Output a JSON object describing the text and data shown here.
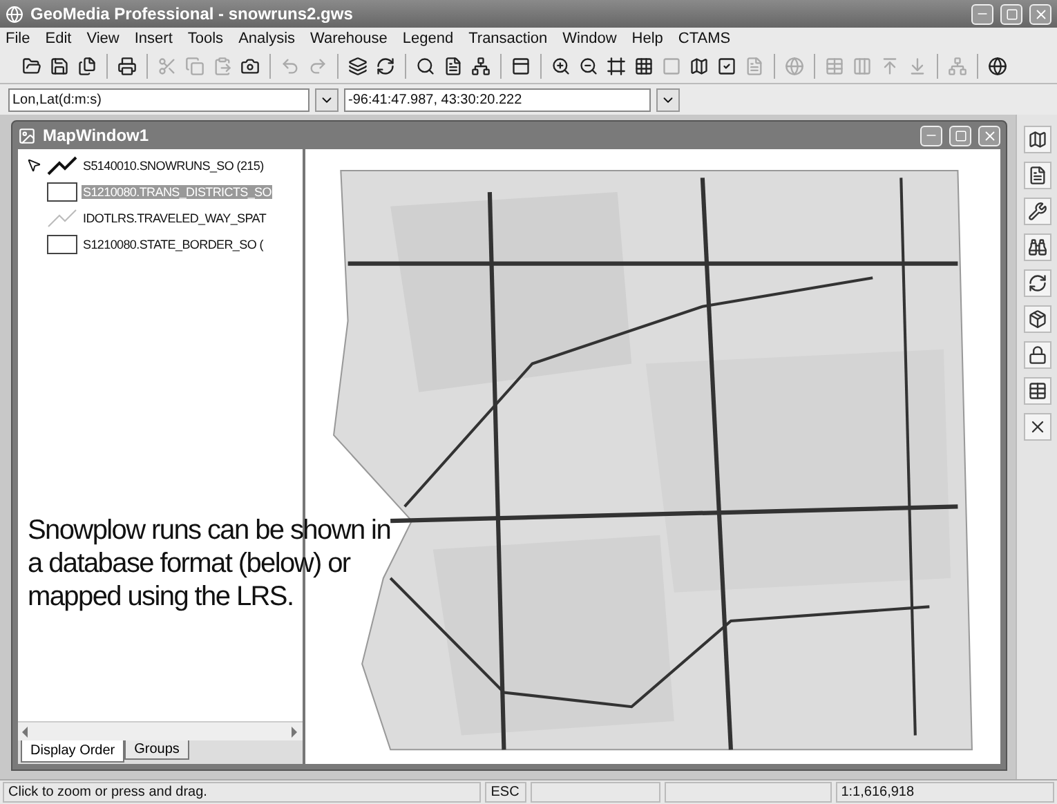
{
  "window": {
    "title": "GeoMedia Professional - snowruns2.gws"
  },
  "menu": [
    "File",
    "Edit",
    "View",
    "Insert",
    "Tools",
    "Analysis",
    "Warehouse",
    "Legend",
    "Transaction",
    "Window",
    "Help",
    "CTAMS"
  ],
  "toolbar_groups": [
    [
      {
        "disabled": false
      },
      {
        "disabled": false
      },
      {
        "disabled": false
      }
    ],
    [
      {
        "disabled": false
      }
    ],
    [
      {
        "disabled": true
      },
      {
        "disabled": true
      },
      {
        "disabled": true
      },
      {
        "disabled": false
      }
    ],
    [
      {
        "disabled": true
      },
      {
        "disabled": true
      }
    ],
    [
      {
        "disabled": false
      },
      {
        "disabled": false
      }
    ],
    [
      {
        "disabled": false
      },
      {
        "disabled": false
      },
      {
        "disabled": false
      }
    ],
    [
      {
        "disabled": false
      }
    ],
    [
      {
        "disabled": false
      },
      {
        "disabled": false
      },
      {
        "disabled": false
      },
      {
        "disabled": false
      },
      {
        "disabled": true
      },
      {
        "disabled": false
      },
      {
        "disabled": false
      },
      {
        "disabled": true
      }
    ],
    [
      {
        "disabled": true
      }
    ],
    [
      {
        "disabled": true
      },
      {
        "disabled": true
      },
      {
        "disabled": true
      },
      {
        "disabled": true
      }
    ],
    [
      {
        "disabled": true
      }
    ],
    [
      {
        "disabled": false
      }
    ]
  ],
  "coordinate_system": {
    "value": "Lon,Lat(d:m:s)"
  },
  "coordinate_readout": {
    "value": "-96:41:47.987, 43:30:20.222"
  },
  "map_window": {
    "title": "MapWindow1"
  },
  "legend": {
    "items": [
      {
        "kind": "line",
        "label": "S5140010.SNOWRUNS_SO (215)",
        "selected": false,
        "pointer": true
      },
      {
        "kind": "area",
        "label": "S1210080.TRANS_DISTRICTS_SO",
        "selected": true,
        "pointer": false
      },
      {
        "kind": "faint-line",
        "label": "IDOTLRS.TRAVELED_WAY_SPAT",
        "selected": false,
        "pointer": false
      },
      {
        "kind": "area",
        "label": "S1210080.STATE_BORDER_SO (",
        "selected": false,
        "pointer": false
      }
    ],
    "tabs": [
      {
        "label": "Display Order",
        "selected": true
      },
      {
        "label": "Groups",
        "selected": false
      }
    ]
  },
  "caption": "Snowplow runs can be shown in a database format (below) or mapped using the LRS.",
  "status_bar": [
    "Click to zoom or press and drag.",
    "ESC",
    "1:1,616,918"
  ]
}
